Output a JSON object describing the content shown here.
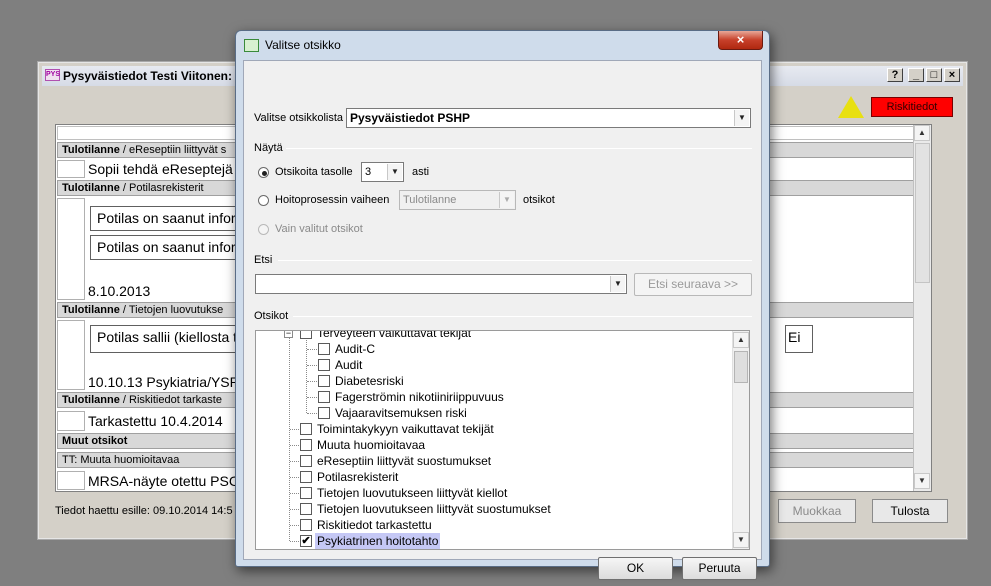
{
  "background_window": {
    "app_icon_text": "PYS",
    "title": "Pysyväistiedot Testi Viitonen: 0",
    "controls": [
      "?",
      "_",
      "□",
      "×"
    ],
    "risk_button": "Riskitiedot",
    "rows": {
      "h1_bold": "Tulotilanne",
      "h1_rest": " / eReseptiin liittyvät s",
      "r1_text": "Sopii tehdä eReseptejä",
      "h2_bold": "Tulotilanne",
      "h2_rest": " / Potilasrekisterit",
      "r2_box1": "Potilas on saanut infor",
      "r2_box2": "Potilas on saanut infor",
      "r2_date": "8.10.2013",
      "h3_bold": "Tulotilanne",
      "h3_rest": " / Tietojen luovutukse",
      "r3_box": "Potilas sallii (kiellosta t",
      "r3_right": "Ei",
      "r3_date": "10.10.13 Psykiatria/YSP",
      "h4_bold": "Tulotilanne",
      "h4_rest": " / Riskitiedot tarkaste",
      "r4_text": "Tarkastettu 10.4.2014",
      "h5": "Muut otsikot",
      "h6": "TT: Muuta huomioitavaa",
      "r6_text": "MRSA-näyte otettu PSC"
    },
    "footer_text": "Tiedot haettu esille:  09.10.2014 14:5",
    "btn_muokkaa": "Muokkaa",
    "btn_tulosta": "Tulosta"
  },
  "dialog": {
    "title": "Valitse otsikko",
    "close_glyph": "×",
    "list_label": "Valitse otsikkolista",
    "list_value": "Pysyväistiedot PSHP",
    "group_nayta": "Näytä",
    "opt_levels_label": "Otsikoita tasolle",
    "opt_levels_value": "3",
    "opt_levels_suffix": "asti",
    "opt_phase_label": "Hoitoprosessin vaiheen",
    "opt_phase_value": "Tulotilanne",
    "opt_phase_suffix": "otsikot",
    "opt_selected_label": "Vain valitut otsikot",
    "group_etsi": "Etsi",
    "search_value": "",
    "search_next": "Etsi seuraava >>",
    "group_otsikot": "Otsikot",
    "tree": [
      {
        "label": "Terveyteen vaikuttavat tekijät",
        "level": 1,
        "checked": false,
        "expander": "−"
      },
      {
        "label": "Audit-C",
        "level": 2,
        "checked": false
      },
      {
        "label": "Audit",
        "level": 2,
        "checked": false
      },
      {
        "label": "Diabetesriski",
        "level": 2,
        "checked": false
      },
      {
        "label": "Fagerströmin nikotiiniriippuvuus",
        "level": 2,
        "checked": false
      },
      {
        "label": "Vajaaravitsemuksen riski",
        "level": 2,
        "checked": false
      },
      {
        "label": "Toimintakykyyn vaikuttavat tekijät",
        "level": 1,
        "checked": false
      },
      {
        "label": "Muuta huomioitavaa",
        "level": 1,
        "checked": false
      },
      {
        "label": "eReseptiin liittyvät suostumukset",
        "level": 1,
        "checked": false
      },
      {
        "label": "Potilasrekisterit",
        "level": 1,
        "checked": false
      },
      {
        "label": "Tietojen luovutukseen liittyvät kiellot",
        "level": 1,
        "checked": false
      },
      {
        "label": "Tietojen luovutukseen liittyvät suostumukset",
        "level": 1,
        "checked": false
      },
      {
        "label": "Riskitiedot tarkastettu",
        "level": 1,
        "checked": false
      },
      {
        "label": "Psykiatrinen hoitotahto",
        "level": 1,
        "checked": true,
        "selected": true
      }
    ],
    "ok": "OK",
    "cancel": "Peruuta"
  },
  "colors": {
    "desktop": "#7f7f7f",
    "risk_red": "#ff0000",
    "warning_yellow": "#e8e010",
    "selection": "#c5c8f5"
  }
}
